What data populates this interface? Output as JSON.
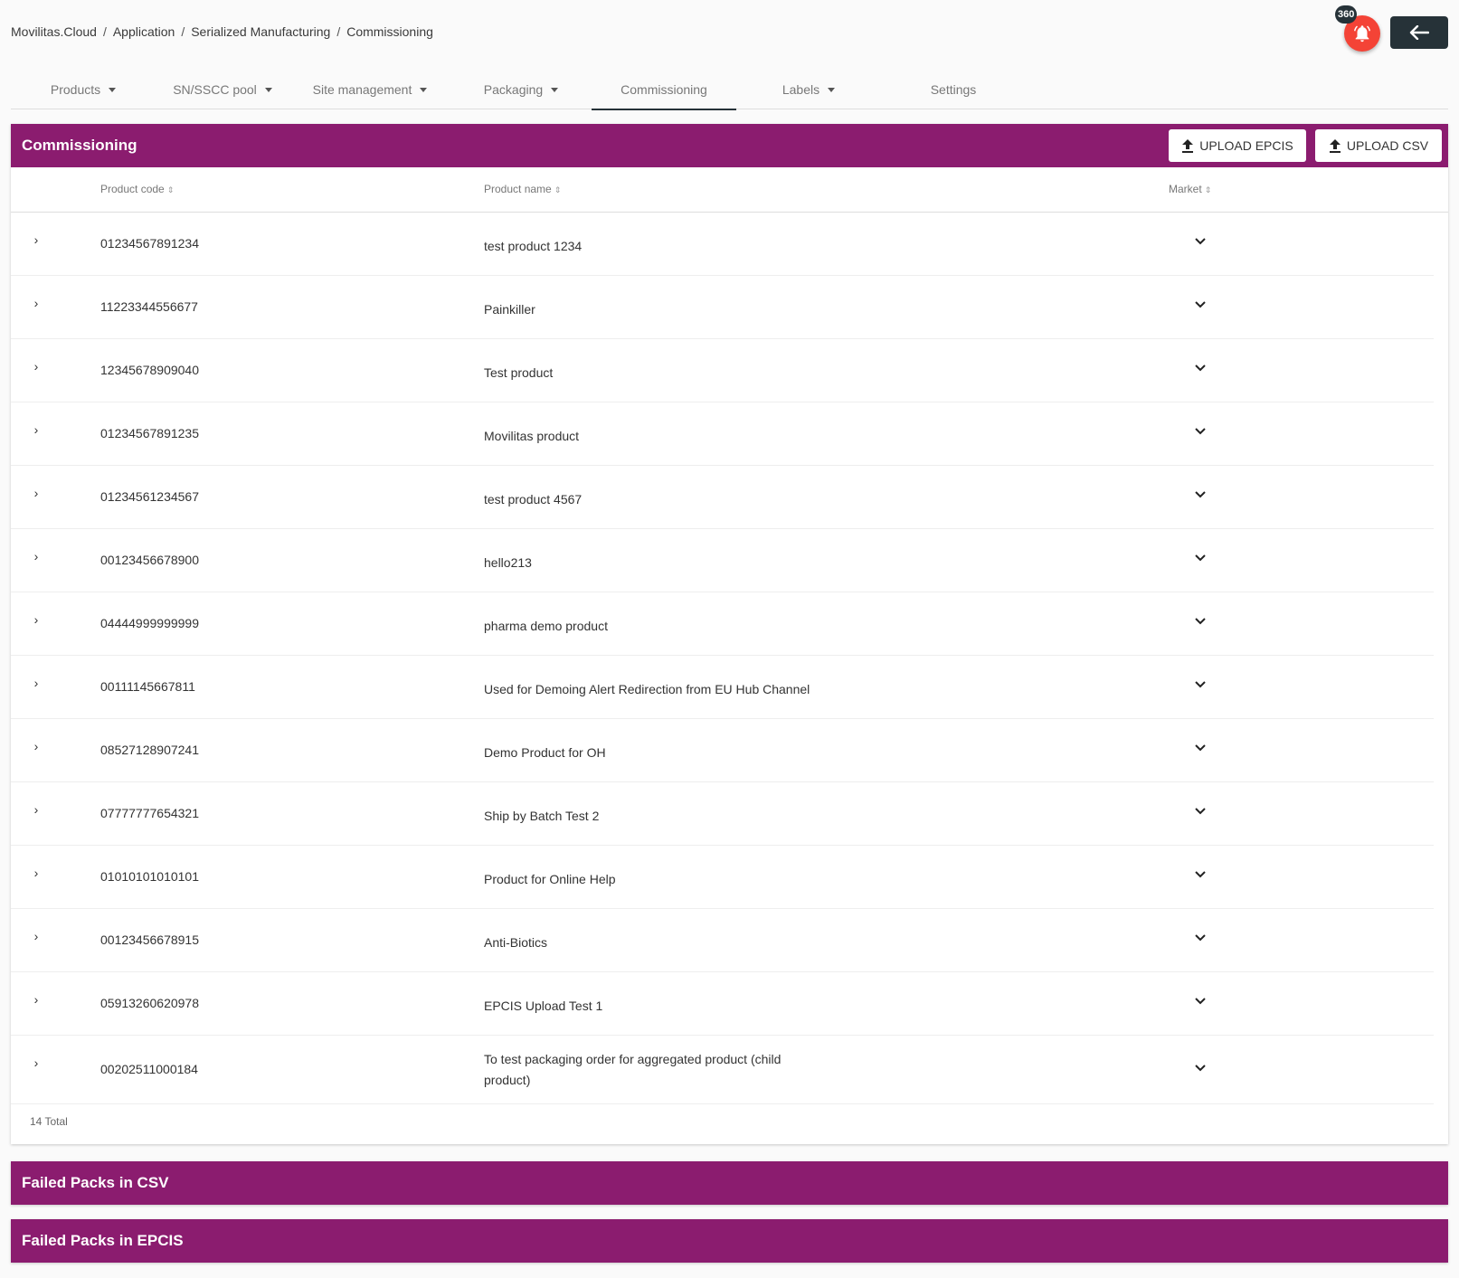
{
  "breadcrumb": [
    "Movilitas.Cloud",
    "Application",
    "Serialized Manufacturing",
    "Commissioning"
  ],
  "notifications": {
    "count": "360"
  },
  "colors": {
    "brand": "#8b1c6f",
    "dark": "#263238",
    "alert": "#f44336"
  },
  "tabs": [
    {
      "label": "Products",
      "dropdown": true
    },
    {
      "label": "SN/SSCC pool",
      "dropdown": true
    },
    {
      "label": "Site management",
      "dropdown": true
    },
    {
      "label": "Packaging",
      "dropdown": true
    },
    {
      "label": "Commissioning",
      "dropdown": false,
      "active": true
    },
    {
      "label": "Labels",
      "dropdown": true
    },
    {
      "label": "Settings",
      "dropdown": false
    }
  ],
  "commissioning": {
    "title": "Commissioning",
    "upload_epcis": "UPLOAD EPCIS",
    "upload_csv": "UPLOAD CSV",
    "columns": {
      "code": "Product code",
      "name": "Product name",
      "market": "Market"
    },
    "rows": [
      {
        "code": "01234567891234",
        "name": "test product 1234"
      },
      {
        "code": "11223344556677",
        "name": "Painkiller"
      },
      {
        "code": "12345678909040",
        "name": "Test product"
      },
      {
        "code": "01234567891235",
        "name": "Movilitas product"
      },
      {
        "code": "01234561234567",
        "name": "test product 4567"
      },
      {
        "code": "00123456678900",
        "name": "hello213"
      },
      {
        "code": "04444999999999",
        "name": "pharma demo product"
      },
      {
        "code": "00111145667811",
        "name": "Used for Demoing Alert Redirection from EU Hub Channel"
      },
      {
        "code": "08527128907241",
        "name": "Demo Product for OH"
      },
      {
        "code": "07777777654321",
        "name": "Ship by Batch Test 2"
      },
      {
        "code": "01010101010101",
        "name": "Product for Online Help"
      },
      {
        "code": "00123456678915",
        "name": "Anti-Biotics"
      },
      {
        "code": "05913260620978",
        "name": "EPCIS Upload Test 1"
      },
      {
        "code": "00202511000184",
        "name": "To test packaging order for aggregated product (child product)"
      }
    ],
    "total": "14 Total"
  },
  "panels": {
    "failed_csv": "Failed Packs in CSV",
    "failed_epcis": "Failed Packs in EPCIS"
  }
}
